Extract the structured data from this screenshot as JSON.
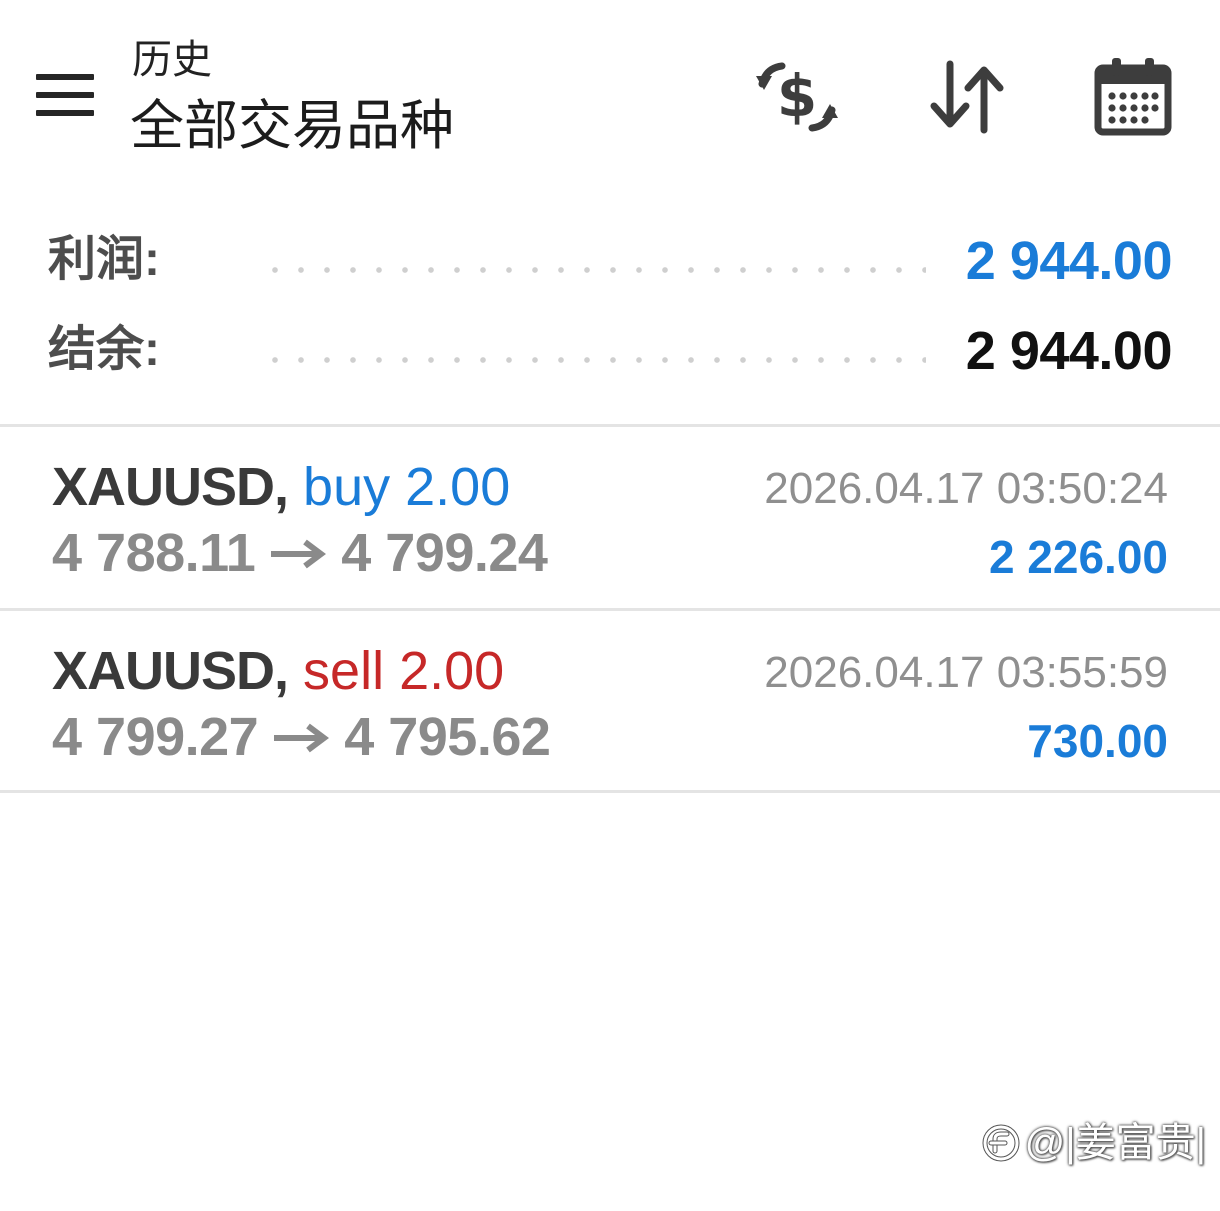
{
  "header": {
    "menu_icon": "hamburger-menu-icon",
    "subtitle": "历史",
    "title": "全部交易品种",
    "actions": [
      {
        "icon": "currency-exchange-icon"
      },
      {
        "icon": "sort-arrows-icon"
      },
      {
        "icon": "calendar-icon"
      }
    ]
  },
  "summary": {
    "profit_label": "利润:",
    "profit_value": "2 944.00",
    "balance_label": "结余:",
    "balance_value": "2 944.00"
  },
  "deals": [
    {
      "symbol": "XAUUSD,",
      "side": "buy",
      "volume": "2.00",
      "open_price": "4 788.11",
      "close_price": "4 799.24",
      "time": "2026.04.17 03:50:24",
      "profit": "2 226.00"
    },
    {
      "symbol": "XAUUSD,",
      "side": "sell",
      "volume": "2.00",
      "open_price": "4 799.27",
      "close_price": "4 795.62",
      "time": "2026.04.17 03:55:59",
      "profit": "730.00"
    }
  ],
  "watermark": {
    "text": "@|姜富贵|",
    "icon": "watermark-logo-icon"
  },
  "colors": {
    "accent_blue": "#1a7cd8",
    "sell_red": "#c62828",
    "muted_gray": "#8a8a8a",
    "icon_dark": "#3d3d3d"
  }
}
